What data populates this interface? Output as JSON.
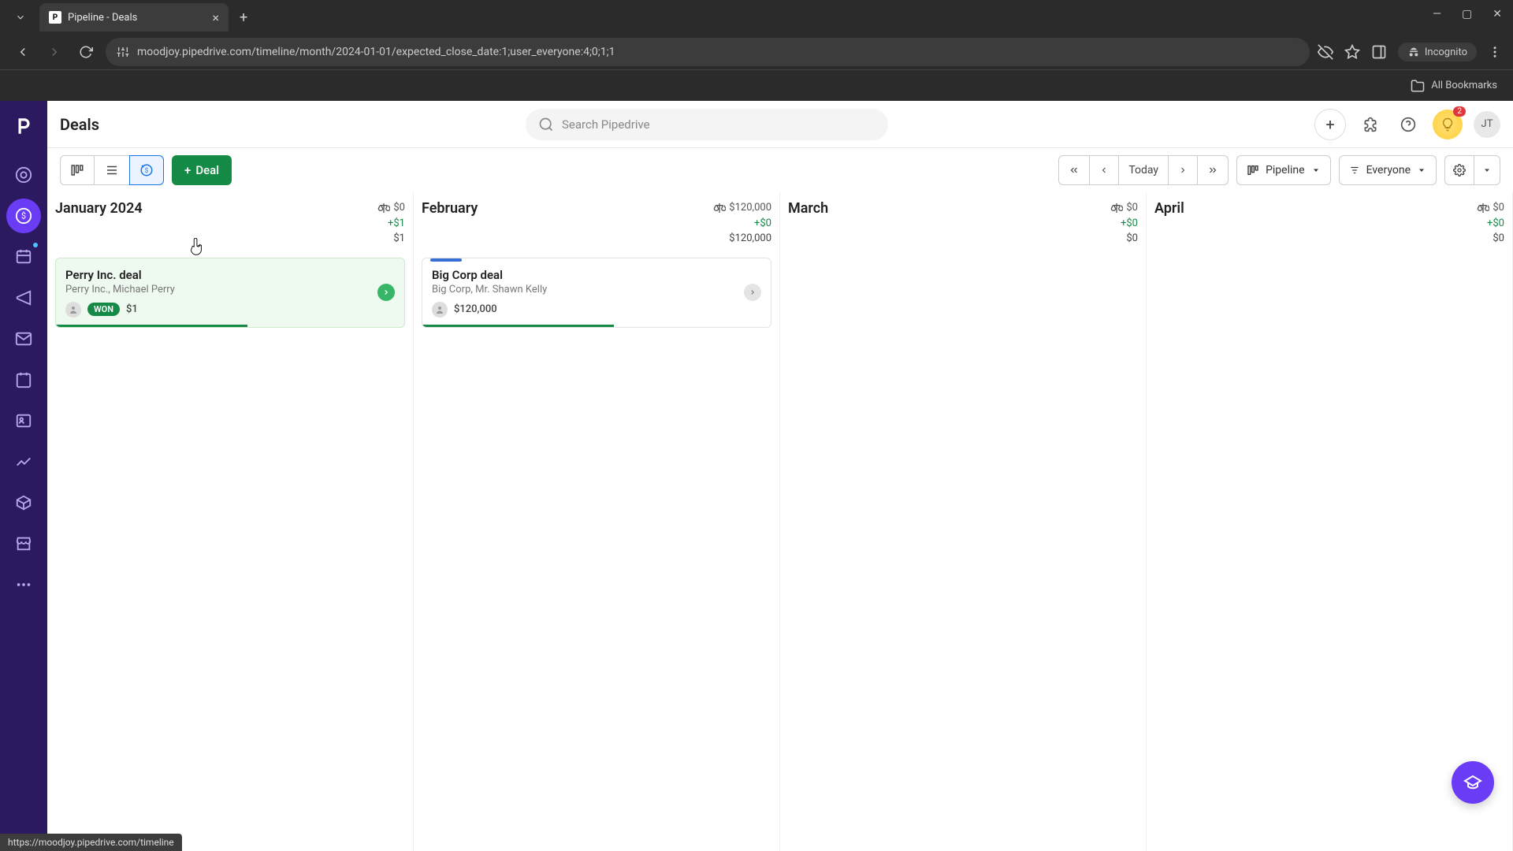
{
  "browser": {
    "tab_title": "Pipeline - Deals",
    "url": "moodjoy.pipedrive.com/timeline/month/2024-01-01/expected_close_date:1;user_everyone:4;0;1;1",
    "incognito_label": "Incognito",
    "bookmarks_label": "All Bookmarks",
    "status_url": "https://moodjoy.pipedrive.com/timeline"
  },
  "header": {
    "page_title": "Deals",
    "search_placeholder": "Search Pipedrive",
    "avatar_initials": "JT",
    "notification_count": "2"
  },
  "toolbar": {
    "deal_button": "Deal",
    "today_label": "Today",
    "pipeline_label": "Pipeline",
    "everyone_label": "Everyone"
  },
  "months": [
    {
      "name": "January 2024",
      "weighted": "$0",
      "delta": "+$1",
      "total": "$1",
      "deals": [
        {
          "title": "Perry Inc. deal",
          "subtitle": "Perry Inc., Michael Perry",
          "value": "$1",
          "won_label": "WON",
          "won": true,
          "arrow": "green",
          "progress_pct": 55
        }
      ]
    },
    {
      "name": "February",
      "weighted": "$120,000",
      "delta": "+$0",
      "total": "$120,000",
      "deals": [
        {
          "title": "Big Corp deal",
          "subtitle": "Big Corp, Mr. Shawn Kelly",
          "value": "$120,000",
          "won": false,
          "arrow": "gray",
          "stripe": true,
          "progress_pct": 55
        }
      ]
    },
    {
      "name": "March",
      "weighted": "$0",
      "delta": "+$0",
      "total": "$0",
      "deals": []
    },
    {
      "name": "April",
      "weighted": "$0",
      "delta": "+$0",
      "total": "$0",
      "deals": []
    }
  ]
}
